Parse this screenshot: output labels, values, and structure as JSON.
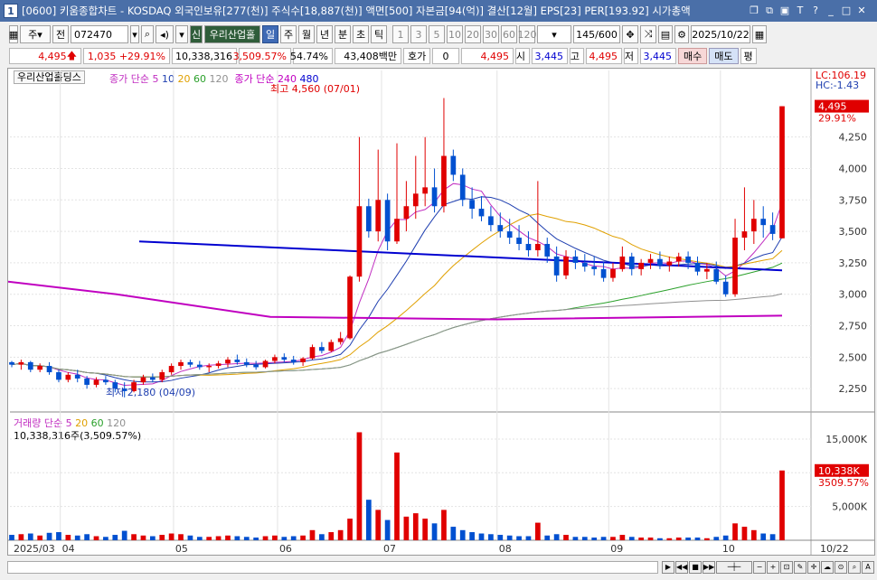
{
  "window": {
    "number": "1",
    "title": "[0600] 키움종합차트 - KOSDAQ 외국인보유[277(천)] 주식수[18,887(천)] 액면[500] 자본금[94(억)] 결산[12월] EPS[23] PER[193.92] 시가총액"
  },
  "toolbar": {
    "period_select": "주",
    "prev_label": "전",
    "code_value": "072470",
    "stock_name": "우리산업홀",
    "badge_sin": "신",
    "period_tabs": [
      "일",
      "주",
      "월",
      "년",
      "분",
      "초",
      "틱"
    ],
    "active_period": "일",
    "minute_buttons": [
      "1",
      "3",
      "5",
      "10",
      "20",
      "30",
      "60",
      "120"
    ],
    "count_value": "145",
    "count_total": "/600",
    "date_value": "2025/10/22"
  },
  "quote": {
    "price": "4,495",
    "change": "1,035",
    "change_pct": "+29.91%",
    "volume": "10,338,316",
    "volume_pct": "3,509.57%",
    "turnover_pct": "54.74%",
    "amount": "43,408백만",
    "hoga_label": "호가",
    "hoga_value": "0",
    "ask": "4,495",
    "open_label": "시",
    "open": "3,445",
    "high_label": "고",
    "high": "4,495",
    "low_label": "저",
    "low": "3,445",
    "buy_label": "매수",
    "sell_label": "매도",
    "eval_label": "평"
  },
  "legend": {
    "stock_name": "우리산업홀딩스",
    "ma_short_label": "종가 단순",
    "ma_short_periods": [
      "5",
      "10",
      "20",
      "60",
      "120"
    ],
    "ma_long_label": "종가 단순",
    "ma_long_periods": [
      "240",
      "480"
    ],
    "lc_label": "LC:106.19",
    "hc_label": "HC:-1.43",
    "price_tag": "4,495",
    "pct_tag": "29.91%",
    "high_annot": "최고 4,560 (07/01)",
    "low_annot": "최저 2,180 (04/09)",
    "vol_label": "거래량",
    "vol_ma_label": "단순",
    "vol_ma_periods": [
      "5",
      "20",
      "60",
      "120"
    ],
    "vol_text": "10,338,316주(3,509.57%)",
    "vol_tag": "10,338K",
    "vol_pct_tag": "3509.57%"
  },
  "colors": {
    "up": "#e00000",
    "down": "#0050d0",
    "ma5": "#c02cc0",
    "ma10": "#1f3fb0",
    "ma20": "#e0a000",
    "ma60": "#2aa02a",
    "ma120": "#909090",
    "ma240": "#c000c0",
    "ma480": "#0000d0"
  },
  "chart_data": {
    "type": "candlestick",
    "y_ticks": [
      "4,250",
      "4,000",
      "3,750",
      "3,500",
      "3,250",
      "3,000",
      "2,750",
      "2,500",
      "2,250"
    ],
    "vol_ticks": [
      "15,000K",
      "10,000K",
      "5,000K"
    ],
    "x_labels": [
      "2025/03",
      "04",
      "05",
      "06",
      "07",
      "08",
      "09",
      "10",
      "10/22"
    ],
    "ylim": [
      2100,
      4650
    ],
    "vol_ylim": [
      0,
      17000
    ],
    "candles": [
      [
        2460,
        2470,
        2420,
        2440,
        800
      ],
      [
        2440,
        2480,
        2400,
        2460,
        900
      ],
      [
        2460,
        2470,
        2380,
        2400,
        1000
      ],
      [
        2400,
        2450,
        2380,
        2430,
        700
      ],
      [
        2430,
        2460,
        2360,
        2380,
        1100
      ],
      [
        2380,
        2400,
        2300,
        2320,
        1200
      ],
      [
        2320,
        2380,
        2300,
        2360,
        800
      ],
      [
        2360,
        2400,
        2300,
        2330,
        700
      ],
      [
        2330,
        2350,
        2250,
        2280,
        900
      ],
      [
        2280,
        2340,
        2260,
        2320,
        600
      ],
      [
        2320,
        2350,
        2280,
        2300,
        500
      ],
      [
        2300,
        2320,
        2220,
        2250,
        800
      ],
      [
        2250,
        2300,
        2180,
        2230,
        1400
      ],
      [
        2230,
        2320,
        2220,
        2300,
        900
      ],
      [
        2300,
        2360,
        2280,
        2340,
        700
      ],
      [
        2340,
        2370,
        2300,
        2320,
        600
      ],
      [
        2320,
        2400,
        2300,
        2380,
        800
      ],
      [
        2380,
        2450,
        2360,
        2430,
        1000
      ],
      [
        2430,
        2480,
        2400,
        2460,
        900
      ],
      [
        2460,
        2480,
        2420,
        2440,
        700
      ],
      [
        2440,
        2470,
        2400,
        2420,
        500
      ],
      [
        2420,
        2450,
        2380,
        2430,
        500
      ],
      [
        2430,
        2470,
        2410,
        2450,
        600
      ],
      [
        2450,
        2500,
        2420,
        2480,
        700
      ],
      [
        2480,
        2520,
        2440,
        2460,
        600
      ],
      [
        2460,
        2490,
        2420,
        2440,
        500
      ],
      [
        2440,
        2470,
        2400,
        2420,
        400
      ],
      [
        2420,
        2480,
        2410,
        2470,
        600
      ],
      [
        2470,
        2520,
        2450,
        2500,
        700
      ],
      [
        2500,
        2530,
        2460,
        2480,
        500
      ],
      [
        2480,
        2510,
        2440,
        2460,
        600
      ],
      [
        2460,
        2500,
        2430,
        2490,
        700
      ],
      [
        2490,
        2600,
        2480,
        2580,
        1500
      ],
      [
        2580,
        2620,
        2530,
        2550,
        900
      ],
      [
        2550,
        2640,
        2540,
        2620,
        1200
      ],
      [
        2620,
        2700,
        2600,
        2650,
        1500
      ],
      [
        2650,
        3150,
        2640,
        3140,
        3200
      ],
      [
        3140,
        4250,
        3100,
        3700,
        16000
      ],
      [
        3700,
        3760,
        3450,
        3500,
        6000
      ],
      [
        3500,
        4150,
        3420,
        3750,
        4500
      ],
      [
        3750,
        3800,
        3350,
        3420,
        3000
      ],
      [
        3420,
        4200,
        3400,
        3600,
        13000
      ],
      [
        3600,
        3900,
        3500,
        3700,
        3500
      ],
      [
        3700,
        4100,
        3600,
        3800,
        4000
      ],
      [
        3800,
        4250,
        3700,
        3850,
        3200
      ],
      [
        3850,
        4000,
        3650,
        3700,
        2500
      ],
      [
        3700,
        4560,
        3650,
        4100,
        4500
      ],
      [
        4100,
        4150,
        3900,
        3950,
        2000
      ],
      [
        3950,
        4000,
        3700,
        3750,
        1500
      ],
      [
        3750,
        3850,
        3600,
        3680,
        1200
      ],
      [
        3680,
        3780,
        3580,
        3620,
        1000
      ],
      [
        3620,
        3700,
        3500,
        3550,
        900
      ],
      [
        3550,
        3650,
        3450,
        3500,
        800
      ],
      [
        3500,
        3600,
        3400,
        3450,
        700
      ],
      [
        3450,
        3550,
        3350,
        3400,
        600
      ],
      [
        3400,
        3500,
        3300,
        3350,
        600
      ],
      [
        3350,
        3900,
        3300,
        3400,
        2600
      ],
      [
        3400,
        3450,
        3250,
        3300,
        700
      ],
      [
        3300,
        3380,
        3100,
        3150,
        900
      ],
      [
        3150,
        3350,
        3120,
        3300,
        800
      ],
      [
        3300,
        3350,
        3200,
        3250,
        500
      ],
      [
        3250,
        3320,
        3180,
        3220,
        500
      ],
      [
        3220,
        3300,
        3150,
        3200,
        400
      ],
      [
        3200,
        3260,
        3100,
        3130,
        500
      ],
      [
        3130,
        3250,
        3100,
        3200,
        500
      ],
      [
        3200,
        3380,
        3180,
        3300,
        800
      ],
      [
        3300,
        3330,
        3150,
        3200,
        500
      ],
      [
        3200,
        3280,
        3150,
        3250,
        400
      ],
      [
        3250,
        3320,
        3200,
        3280,
        400
      ],
      [
        3280,
        3340,
        3200,
        3230,
        300
      ],
      [
        3230,
        3300,
        3180,
        3260,
        300
      ],
      [
        3260,
        3330,
        3220,
        3300,
        400
      ],
      [
        3300,
        3340,
        3200,
        3250,
        400
      ],
      [
        3250,
        3300,
        3150,
        3180,
        400
      ],
      [
        3180,
        3250,
        3120,
        3200,
        300
      ],
      [
        3200,
        3260,
        3080,
        3100,
        500
      ],
      [
        3100,
        3150,
        2980,
        3000,
        700
      ],
      [
        3000,
        3600,
        2980,
        3450,
        2500
      ],
      [
        3450,
        3850,
        3350,
        3500,
        2000
      ],
      [
        3500,
        3750,
        3400,
        3600,
        1500
      ],
      [
        3600,
        3700,
        3450,
        3550,
        1000
      ],
      [
        3550,
        3650,
        3430,
        3480,
        900
      ],
      [
        3445,
        4495,
        3445,
        4495,
        10338
      ]
    ]
  }
}
